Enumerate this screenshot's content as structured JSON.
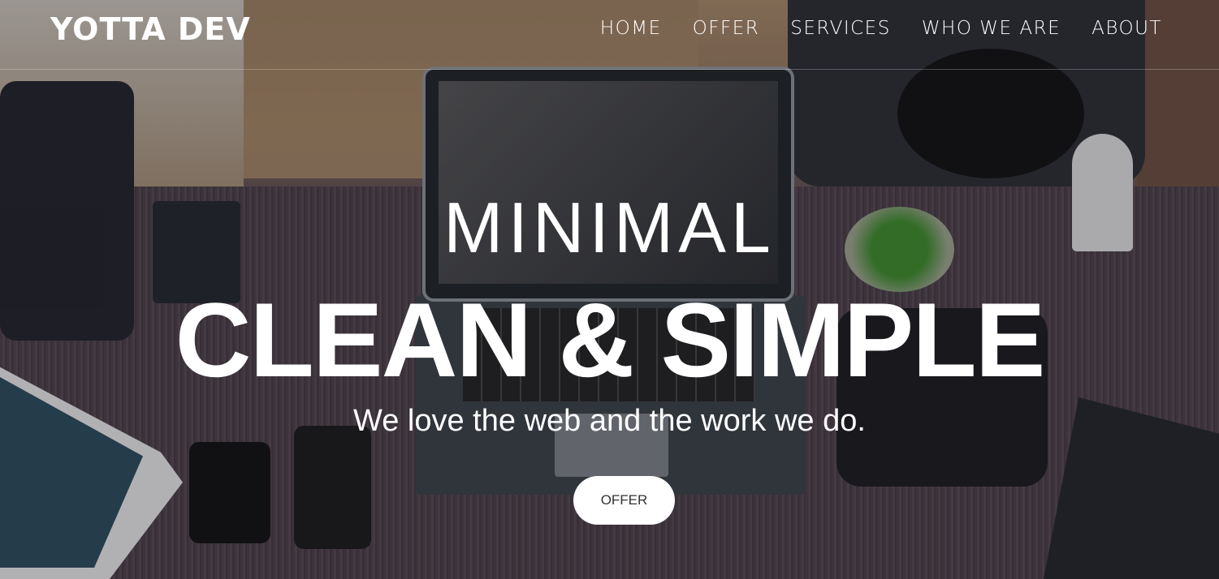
{
  "brand": "YOTTA DEV",
  "nav": [
    "HOME",
    "OFFER",
    "SERVICES",
    "WHO WE ARE",
    "ABOUT"
  ],
  "hero": {
    "title": "MINIMAL",
    "headline": "CLEAN & SIMPLE",
    "subtitle": "We love the web and the work we do.",
    "button": "OFFER"
  }
}
